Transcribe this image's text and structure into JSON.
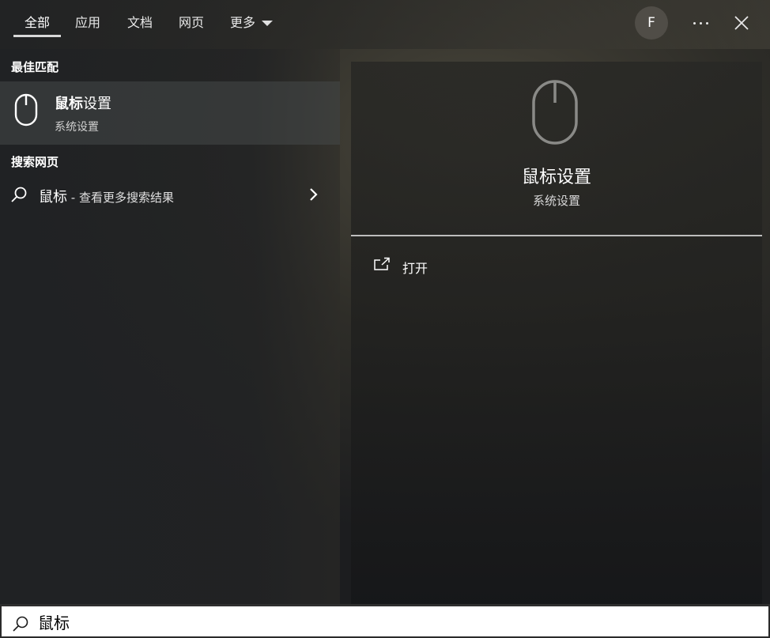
{
  "tabs": [
    {
      "label": "全部",
      "active": true
    },
    {
      "label": "应用",
      "active": false
    },
    {
      "label": "文档",
      "active": false
    },
    {
      "label": "网页",
      "active": false
    },
    {
      "label": "更多",
      "active": false
    }
  ],
  "header": {
    "avatar_initial": "F"
  },
  "best_match": {
    "section_label": "最佳匹配",
    "title_bold": "鼠标",
    "title_rest": "设置",
    "subtitle": "系统设置",
    "icon": "mouse-icon"
  },
  "web_search": {
    "section_label": "搜索网页",
    "query": "鼠标",
    "suffix": " - 查看更多搜索结果",
    "icon": "search-icon"
  },
  "detail": {
    "title": "鼠标设置",
    "subtitle": "系统设置",
    "actions": [
      {
        "label": "打开",
        "icon": "open-in-new-icon"
      }
    ]
  },
  "search": {
    "value": "鼠标",
    "icon": "search-icon"
  },
  "colors": {
    "accent_underline": "#d8d8d8",
    "search_bar_bg": "#ffffff"
  }
}
